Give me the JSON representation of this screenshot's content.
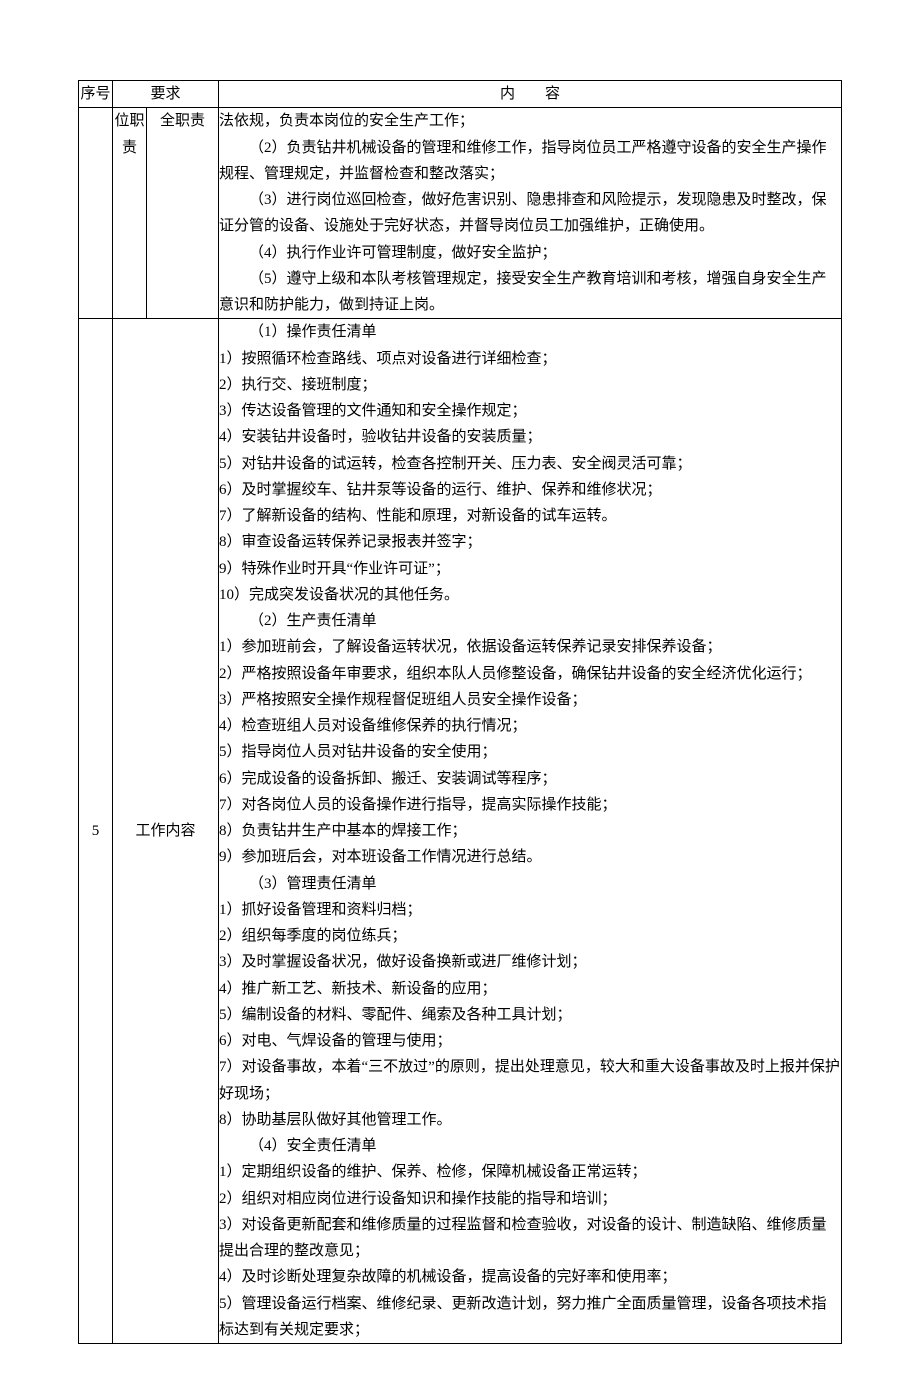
{
  "headers": {
    "seq": "序号",
    "req": "要求",
    "content_spaced": "内　　容"
  },
  "row4": {
    "req_col_a": "位职责",
    "req_col_b": "全职责",
    "content": [
      {
        "cls": "line",
        "text": "法依规，负责本岗位的安全生产工作；"
      },
      {
        "cls": "indent2",
        "text": "（2）负责钻井机械设备的管理和维修工作，指导岗位员工严格遵守设备的安全生产操作规程、管理规定，并监督检查和整改落实；"
      },
      {
        "cls": "indent2",
        "text": "（3）进行岗位巡回检查，做好危害识别、隐患排查和风险提示，发现隐患及时整改，保证分管的设备、设施处于完好状态，并督导岗位员工加强维护，正确使用。"
      },
      {
        "cls": "indent2",
        "text": "（4）执行作业许可管理制度，做好安全监护；"
      },
      {
        "cls": "indent2",
        "text": "（5）遵守上级和本队考核管理规定，接受安全生产教育培训和考核，增强自身安全生产意识和防护能力，做到持证上岗。"
      }
    ]
  },
  "row5": {
    "seq": "5",
    "req": "工作内容",
    "content": [
      {
        "cls": "indent2",
        "text": "（1）操作责任清单"
      },
      {
        "cls": "line",
        "text": "1）按照循环检查路线、项点对设备进行详细检查；"
      },
      {
        "cls": "line",
        "text": "2）执行交、接班制度；"
      },
      {
        "cls": "line",
        "text": "3）传达设备管理的文件通知和安全操作规定；"
      },
      {
        "cls": "line",
        "text": "4）安装钻井设备时，验收钻井设备的安装质量；"
      },
      {
        "cls": "line",
        "text": "5）对钻井设备的试运转，检查各控制开关、压力表、安全阀灵活可靠；"
      },
      {
        "cls": "line",
        "text": "6）及时掌握绞车、钻井泵等设备的运行、维护、保养和维修状况；"
      },
      {
        "cls": "line",
        "text": "7）了解新设备的结构、性能和原理，对新设备的试车运转。"
      },
      {
        "cls": "line",
        "text": "8）审查设备运转保养记录报表并签字；"
      },
      {
        "cls": "line",
        "text": "9）特殊作业时开具“作业许可证”；"
      },
      {
        "cls": "line",
        "text": "10）完成突发设备状况的其他任务。"
      },
      {
        "cls": "indent2",
        "text": "（2）生产责任清单"
      },
      {
        "cls": "line",
        "text": "1）参加班前会，了解设备运转状况，依据设备运转保养记录安排保养设备；"
      },
      {
        "cls": "line",
        "text": "2）严格按照设备年审要求，组织本队人员修整设备，确保钻井设备的安全经济优化运行；"
      },
      {
        "cls": "line",
        "text": "3）严格按照安全操作规程督促班组人员安全操作设备；"
      },
      {
        "cls": "line",
        "text": "4）检查班组人员对设备维修保养的执行情况；"
      },
      {
        "cls": "line",
        "text": "5）指导岗位人员对钻井设备的安全使用；"
      },
      {
        "cls": "line",
        "text": "6）完成设备的设备拆卸、搬迁、安装调试等程序；"
      },
      {
        "cls": "line",
        "text": "7）对各岗位人员的设备操作进行指导，提高实际操作技能；"
      },
      {
        "cls": "line",
        "text": "8）负责钻井生产中基本的焊接工作；"
      },
      {
        "cls": "line",
        "text": "9）参加班后会，对本班设备工作情况进行总结。"
      },
      {
        "cls": "indent2",
        "text": "（3）管理责任清单"
      },
      {
        "cls": "line",
        "text": "1）抓好设备管理和资料归档；"
      },
      {
        "cls": "line",
        "text": "2）组织每季度的岗位练兵；"
      },
      {
        "cls": "line",
        "text": "3）及时掌握设备状况，做好设备换新或进厂维修计划；"
      },
      {
        "cls": "line",
        "text": "4）推广新工艺、新技术、新设备的应用；"
      },
      {
        "cls": "line",
        "text": "5）编制设备的材料、零配件、绳索及各种工具计划；"
      },
      {
        "cls": "line",
        "text": "6）对电、气焊设备的管理与使用；"
      },
      {
        "cls": "line",
        "text": "7）对设备事故，本着“三不放过”的原则，提出处理意见，较大和重大设备事故及时上报并保护好现场；"
      },
      {
        "cls": "line",
        "text": "8）协助基层队做好其他管理工作。"
      },
      {
        "cls": "indent2",
        "text": "（4）安全责任清单"
      },
      {
        "cls": "line",
        "text": "1）定期组织设备的维护、保养、检修，保障机械设备正常运转；"
      },
      {
        "cls": "line",
        "text": "2）组织对相应岗位进行设备知识和操作技能的指导和培训；"
      },
      {
        "cls": "line",
        "text": "3）对设备更新配套和维修质量的过程监督和检查验收，对设备的设计、制造缺陷、维修质量提出合理的整改意见；"
      },
      {
        "cls": "line",
        "text": "4）及时诊断处理复杂故障的机械设备，提高设备的完好率和使用率；"
      },
      {
        "cls": "line",
        "text": "5）管理设备运行档案、维修纪录、更新改造计划，努力推广全面质量管理，设备各项技术指标达到有关规定要求；"
      }
    ]
  }
}
